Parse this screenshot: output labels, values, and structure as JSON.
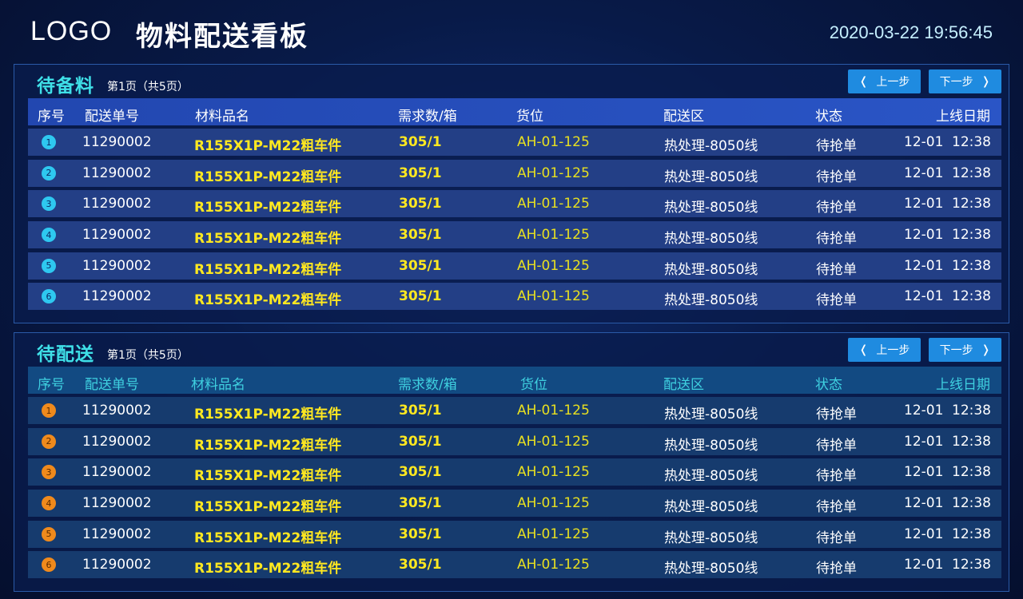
{
  "header": {
    "logo": "LOGO",
    "title": "物料配送看板",
    "datetime": "2020-03-22 19:56:45"
  },
  "columns": [
    "序号",
    "配送单号",
    "材料品名",
    "需求数/箱",
    "货位",
    "配送区",
    "状态",
    "上线日期"
  ],
  "buttons": {
    "prev": "上一步",
    "next": "下一步"
  },
  "panel_a": {
    "title": "待备料",
    "page_info": "第1页（共5页）",
    "rows": [
      {
        "idx": "1",
        "order": "11290002",
        "material": "R155X1P-M22粗车件",
        "qty": "305/1",
        "location": "AH-01-125",
        "zone": "热处理-8050线",
        "status": "待抢单",
        "date": "12-01",
        "time": "12:38"
      },
      {
        "idx": "2",
        "order": "11290002",
        "material": "R155X1P-M22粗车件",
        "qty": "305/1",
        "location": "AH-01-125",
        "zone": "热处理-8050线",
        "status": "待抢单",
        "date": "12-01",
        "time": "12:38"
      },
      {
        "idx": "3",
        "order": "11290002",
        "material": "R155X1P-M22粗车件",
        "qty": "305/1",
        "location": "AH-01-125",
        "zone": "热处理-8050线",
        "status": "待抢单",
        "date": "12-01",
        "time": "12:38"
      },
      {
        "idx": "4",
        "order": "11290002",
        "material": "R155X1P-M22粗车件",
        "qty": "305/1",
        "location": "AH-01-125",
        "zone": "热处理-8050线",
        "status": "待抢单",
        "date": "12-01",
        "time": "12:38"
      },
      {
        "idx": "5",
        "order": "11290002",
        "material": "R155X1P-M22粗车件",
        "qty": "305/1",
        "location": "AH-01-125",
        "zone": "热处理-8050线",
        "status": "待抢单",
        "date": "12-01",
        "time": "12:38"
      },
      {
        "idx": "6",
        "order": "11290002",
        "material": "R155X1P-M22粗车件",
        "qty": "305/1",
        "location": "AH-01-125",
        "zone": "热处理-8050线",
        "status": "待抢单",
        "date": "12-01",
        "time": "12:38"
      }
    ]
  },
  "panel_b": {
    "title": "待配送",
    "page_info": "第1页（共5页）",
    "rows": [
      {
        "idx": "1",
        "order": "11290002",
        "material": "R155X1P-M22粗车件",
        "qty": "305/1",
        "location": "AH-01-125",
        "zone": "热处理-8050线",
        "status": "待抢单",
        "date": "12-01",
        "time": "12:38"
      },
      {
        "idx": "2",
        "order": "11290002",
        "material": "R155X1P-M22粗车件",
        "qty": "305/1",
        "location": "AH-01-125",
        "zone": "热处理-8050线",
        "status": "待抢单",
        "date": "12-01",
        "time": "12:38"
      },
      {
        "idx": "3",
        "order": "11290002",
        "material": "R155X1P-M22粗车件",
        "qty": "305/1",
        "location": "AH-01-125",
        "zone": "热处理-8050线",
        "status": "待抢单",
        "date": "12-01",
        "time": "12:38"
      },
      {
        "idx": "4",
        "order": "11290002",
        "material": "R155X1P-M22粗车件",
        "qty": "305/1",
        "location": "AH-01-125",
        "zone": "热处理-8050线",
        "status": "待抢单",
        "date": "12-01",
        "time": "12:38"
      },
      {
        "idx": "5",
        "order": "11290002",
        "material": "R155X1P-M22粗车件",
        "qty": "305/1",
        "location": "AH-01-125",
        "zone": "热处理-8050线",
        "status": "待抢单",
        "date": "12-01",
        "time": "12:38"
      },
      {
        "idx": "6",
        "order": "11290002",
        "material": "R155X1P-M22粗车件",
        "qty": "305/1",
        "location": "AH-01-125",
        "zone": "热处理-8050线",
        "status": "待抢单",
        "date": "12-01",
        "time": "12:38"
      }
    ]
  },
  "colors": {
    "accent_cyan": "#3fe0e8",
    "button_blue": "#1f8be0",
    "value_yellow": "#ffe820",
    "badge_cyan": "#2ec8f0",
    "badge_orange": "#f08a1c"
  },
  "icons": {
    "prev": "chevron-left-icon",
    "next": "chevron-right-icon"
  }
}
